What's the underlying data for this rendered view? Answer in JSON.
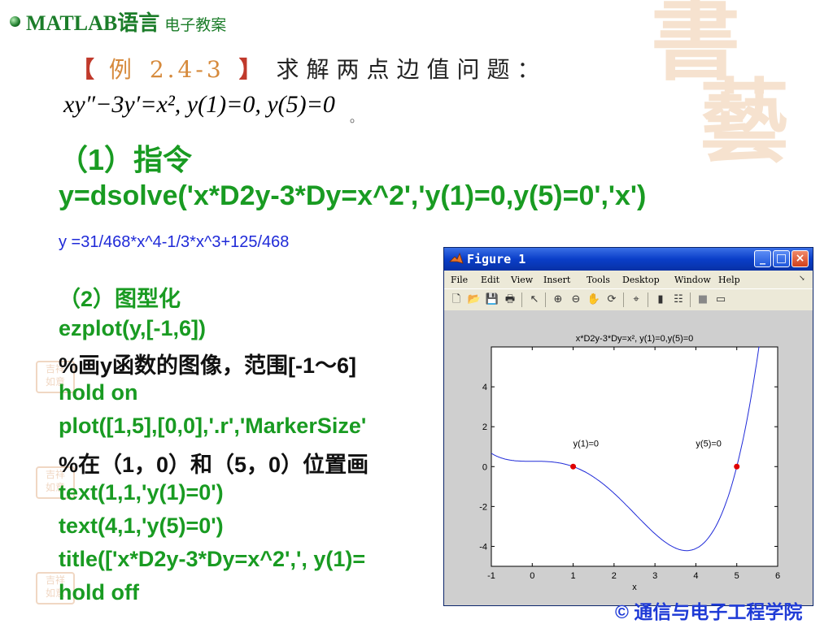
{
  "header": {
    "title": "MATLAB语言",
    "subtitle": "电子教案"
  },
  "example": {
    "bracket_open": "【",
    "label": "例",
    "number": "2.4-3",
    "bracket_close": "】",
    "text": "求解两点边值问题：",
    "equation": "xy″−3y′=x², y(1)=0, y(5)=0",
    "equation_tail": "。"
  },
  "step1": {
    "label": "（1）指令",
    "command": "y=dsolve('x*D2y-3*Dy=x^2','y(1)=0,y(5)=0','x')"
  },
  "result": "y =31/468*x^4-1/3*x^3+125/468",
  "step2": {
    "label": "（2）图型化"
  },
  "code_lines": [
    "ezplot(y,[-1,6])",
    "%画y函数的图像，范围[-1～6]",
    "hold on",
    "plot([1,5],[0,0],'.r','MarkerSize'",
    "%在（1，0）和（5，0）位置画",
    "text(1,1,'y(1)=0')",
    "text(4,1,'y(5)=0')",
    "title(['x*D2y-3*Dy=x^2',',  y(1)=",
    "hold off"
  ],
  "footer": "© 通信与电子工程学院",
  "figure_window": {
    "title": "Figure 1",
    "buttons": {
      "minimize": "_",
      "maximize": "□",
      "close": "×"
    },
    "menu": [
      "File",
      "Edit",
      "View",
      "Insert",
      "Tools",
      "Desktop",
      "Window",
      "Help"
    ],
    "toolbar_icons": [
      "new-file-icon",
      "open-folder-icon",
      "save-icon",
      "print-icon",
      "pointer-icon",
      "zoom-in-icon",
      "zoom-out-icon",
      "pan-hand-icon",
      "rotate-icon",
      "data-cursor-icon",
      "colorbar-icon",
      "legend-icon",
      "hide-plot-tools-icon",
      "show-plot-tools-icon"
    ],
    "colors": {
      "titlebar": "#0a3ec8",
      "curve": "#1f2ad8",
      "marker": "#e00000"
    }
  },
  "chart_data": {
    "type": "line",
    "title": "x*D2y-3*Dy=x², y(1)=0,y(5)=0",
    "xlabel": "x",
    "ylabel": "",
    "xlim": [
      -1,
      6
    ],
    "ylim": [
      -5,
      6
    ],
    "xticks": [
      -1,
      0,
      1,
      2,
      3,
      4,
      5,
      6
    ],
    "yticks": [
      -4,
      -2,
      0,
      2,
      4
    ],
    "grid": false,
    "series": [
      {
        "function": "31/468*x^4-1/3*x^3+125/468",
        "x": [
          -1,
          -0.5,
          0,
          0.5,
          1,
          1.5,
          2,
          2.5,
          3,
          3.5,
          3.75,
          4,
          4.5,
          5,
          5.5,
          5.75
        ],
        "values": [
          0.667,
          0.313,
          0.267,
          0.229,
          0,
          -0.523,
          -1.33,
          -2.27,
          -3.137,
          -3.675,
          -3.73,
          -3.541,
          -1.802,
          0,
          5.76,
          10.17
        ]
      }
    ],
    "markers": [
      {
        "x": 1,
        "y": 0
      },
      {
        "x": 5,
        "y": 0
      }
    ],
    "annotations": [
      {
        "x": 1,
        "y": 1,
        "text": "y(1)=0"
      },
      {
        "x": 4,
        "y": 1,
        "text": "y(5)=0"
      }
    ]
  }
}
